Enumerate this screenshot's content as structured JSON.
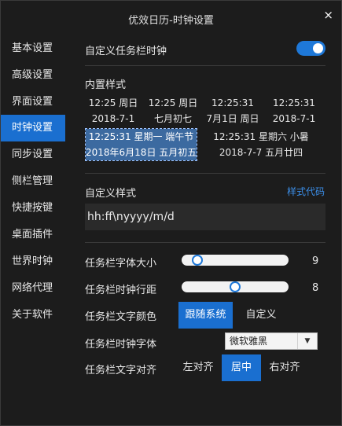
{
  "window": {
    "title": "优效日历-时钟设置",
    "close_glyph": "×"
  },
  "sidebar": {
    "items": [
      {
        "label": "基本设置"
      },
      {
        "label": "高级设置"
      },
      {
        "label": "界面设置"
      },
      {
        "label": "时钟设置",
        "active": true
      },
      {
        "label": "同步设置"
      },
      {
        "label": "侧栏管理"
      },
      {
        "label": "快捷按键"
      },
      {
        "label": "桌面插件"
      },
      {
        "label": "世界时钟"
      },
      {
        "label": "网络代理"
      },
      {
        "label": "关于软件"
      }
    ]
  },
  "custom_clock": {
    "label": "自定义任务栏时钟",
    "enabled": true
  },
  "builtin": {
    "label": "内置样式",
    "presets": [
      {
        "line1": "12:25 周日",
        "line2": "2018-7-1"
      },
      {
        "line1": "12:25 周日",
        "line2": "七月初七"
      },
      {
        "line1": "12:25:31",
        "line2": "7月1日 周日"
      },
      {
        "line1": "12:25:31",
        "line2": "2018-7-1"
      },
      {
        "line1": "12:25:31 星期一 端午节",
        "line2": "2018年6月18日 五月初五",
        "selected": true
      },
      {
        "line1": "12:25:31 星期六 小暑",
        "line2": "2018-7-7 五月廿四"
      }
    ]
  },
  "custom_style": {
    "label": "自定义样式",
    "code_link": "样式代码",
    "format": "hh:ff\\nyyyy/m/d"
  },
  "font_size": {
    "label": "任务栏字体大小",
    "value": "9",
    "level": 0.15
  },
  "line_spacing": {
    "label": "任务栏时钟行距",
    "value": "8",
    "level": 0.5
  },
  "text_color": {
    "label": "任务栏文字颜色",
    "options": [
      "跟随系统",
      "自定义"
    ],
    "active": "跟随系统"
  },
  "clock_font": {
    "label": "任务栏时钟字体",
    "value": "微软雅黑"
  },
  "text_align": {
    "label": "任务栏文字对齐",
    "options": [
      "左对齐",
      "居中",
      "右对齐"
    ],
    "active": "居中"
  },
  "colors": {
    "accent": "#1a6fd0",
    "background": "#1c1c1c",
    "link": "#3b8ee8"
  },
  "icons": {
    "close": "close-icon",
    "dropdown": "chevron-down-icon"
  }
}
